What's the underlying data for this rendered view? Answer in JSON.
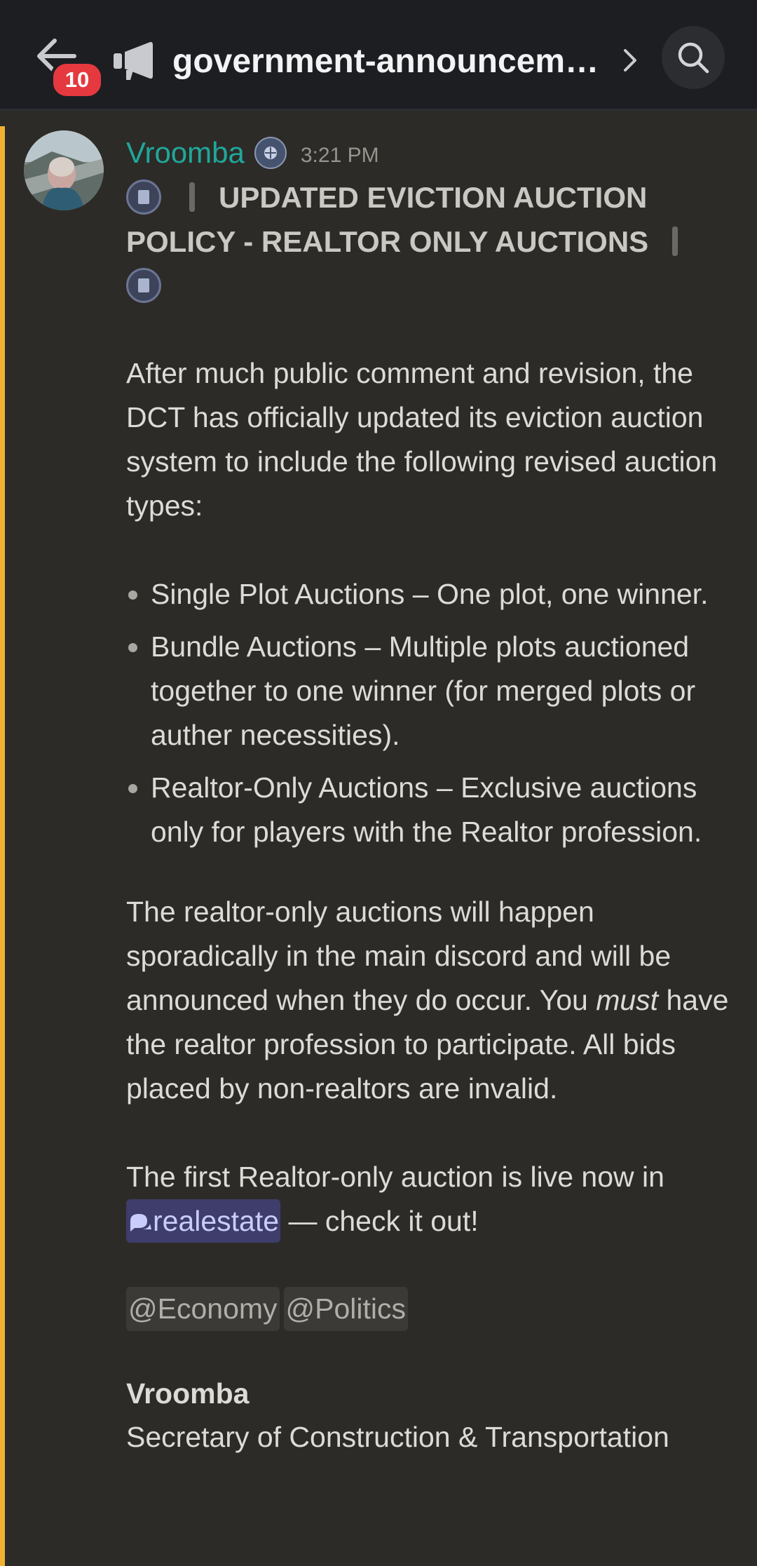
{
  "header": {
    "unread_count": "10",
    "channel_name": "government-announceme...",
    "icons": {
      "back": "arrow-left-icon",
      "channel": "megaphone-icon",
      "chevron": "chevron-right-icon",
      "search": "search-icon"
    }
  },
  "colors": {
    "header_bg": "#1d1e22",
    "message_bg": "#2d2b27",
    "highlight": "#f0b132",
    "username": "#1fa89b",
    "unread_badge": "#e5393f",
    "channel_mention_bg": "#3f3d6b"
  },
  "message": {
    "author": "Vroomba",
    "timestamp": "3:21 PM",
    "title": "UPDATED EVICTION AUCTION POLICY - REALTOR ONLY AUCTIONS",
    "intro": "After much public comment and revision, the DCT has officially updated its eviction auction system to include the following revised auction types:",
    "bullets": [
      "Single Plot Auctions – One plot, one winner.",
      "Bundle Auctions – Multiple plots auctioned together to one winner (for merged plots or auther necessities).",
      "Realtor-Only Auctions – Exclusive auctions only for players with the Realtor profession."
    ],
    "realtor_para": {
      "before": "The realtor-only auctions will happen sporadically in the main discord and will be announced when they do occur. You ",
      "emphasis": "must",
      "after": " have the realtor profession to participate. All bids placed by non-realtors are invalid."
    },
    "first_auction": {
      "before": "The first Realtor-only auction is live now in",
      "channel_mention": "realestate",
      "after": " — check it out!"
    },
    "role_mentions": [
      "@Economy",
      "@Politics"
    ],
    "signature": {
      "name": "Vroomba",
      "title": "Secretary of Construction & Transportation"
    }
  }
}
